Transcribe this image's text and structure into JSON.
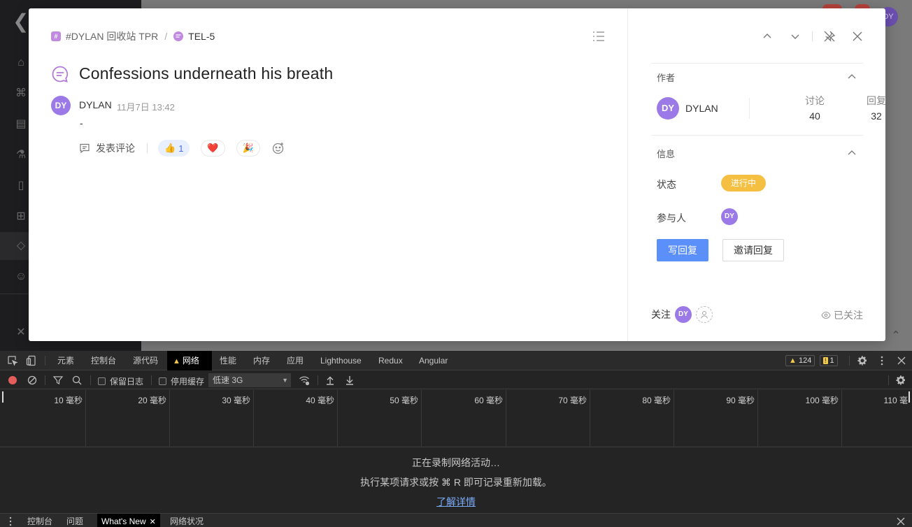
{
  "modal": {
    "breadcrumb": {
      "channel": "#DYLAN 回收站 TPR",
      "separator": "/",
      "topic": "TEL-5"
    },
    "title": "Confessions underneath his breath",
    "post": {
      "avatar": "DY",
      "author": "DYLAN",
      "time": "11月7日 13:42",
      "body": "-",
      "comment_label": "发表评论",
      "reactions": [
        {
          "emoji": "👍",
          "count": "1"
        },
        {
          "emoji": "❤️",
          "count": ""
        },
        {
          "emoji": "🎉",
          "count": ""
        }
      ]
    },
    "side": {
      "author_section": "作者",
      "author_avatar": "DY",
      "author_name": "DYLAN",
      "discussions_label": "讨论",
      "discussions_value": "40",
      "replies_label": "回复",
      "replies_value": "32",
      "info_section": "信息",
      "status_label": "状态",
      "status_value": "进行中",
      "participants_label": "参与人",
      "participant_avatar": "DY",
      "reply_button": "写回复",
      "invite_button": "邀请回复",
      "follow_label": "关注",
      "follower_avatar": "DY",
      "followed_label": "已关注"
    },
    "colors": {
      "accent": "#5b8ff9",
      "avatar": "#9b7ae8",
      "status": "#f5c042",
      "topic_icon": "#c08ae0"
    }
  },
  "background": {
    "top_avatar": "DY"
  },
  "devtools": {
    "tabs": [
      "元素",
      "控制台",
      "源代码",
      "网络",
      "性能",
      "内存",
      "应用",
      "Lighthouse",
      "Redux",
      "Angular"
    ],
    "active_tab": "网络",
    "warnings_count": "124",
    "messages_count": "1",
    "toolbar": {
      "preserve_log": "保留日志",
      "disable_cache": "停用缓存",
      "throttling": "低速 3G"
    },
    "timeline_ticks": [
      "10 毫秒",
      "20 毫秒",
      "30 毫秒",
      "40 毫秒",
      "50 毫秒",
      "60 毫秒",
      "70 毫秒",
      "80 毫秒",
      "90 毫秒",
      "100 毫秒",
      "110 毫"
    ],
    "empty": {
      "line1": "正在录制网络活动…",
      "line2": "执行某项请求或按 ⌘ R 即可记录重新加载。",
      "link": "了解详情"
    },
    "drawer_tabs": [
      "控制台",
      "问题",
      "What's New",
      "网络状况"
    ],
    "drawer_active": "What's New"
  }
}
